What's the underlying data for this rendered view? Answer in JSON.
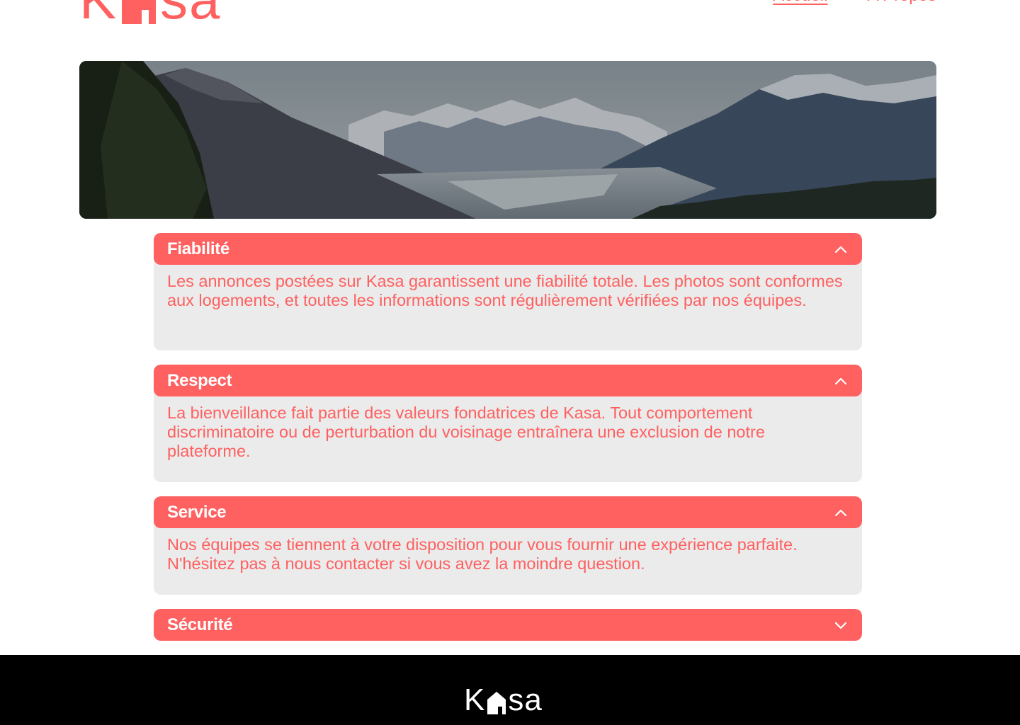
{
  "brand": {
    "logo_left": "K",
    "logo_right": "sa",
    "color": "#ff6060"
  },
  "nav": {
    "items": [
      {
        "label": "Accueil"
      },
      {
        "label": "A Propos"
      }
    ]
  },
  "banner": {
    "image": "mountain landscape banner"
  },
  "collapses": [
    {
      "title": "Fiabilité",
      "expanded": true,
      "icon": "chevron-up-icon",
      "text": "Les annonces postées sur Kasa garantissent une fiabilité totale. Les photos sont conformes aux logements, et toutes les informations sont régulièrement vérifiées par nos équipes."
    },
    {
      "title": "Respect",
      "expanded": true,
      "icon": "chevron-up-icon",
      "text": "La bienveillance fait partie des valeurs fondatrices de Kasa. Tout comportement discriminatoire ou de perturbation du voisinage entraînera une exclusion de notre plateforme."
    },
    {
      "title": "Service",
      "expanded": true,
      "icon": "chevron-up-icon",
      "text": "Nos équipes se tiennent à votre disposition pour vous fournir une expérience parfaite. N'hésitez pas à nous contacter si vous avez la moindre question."
    },
    {
      "title": "Sécurité",
      "expanded": false,
      "icon": "chevron-down-icon",
      "text": ""
    }
  ],
  "footer": {
    "logo_left": "K",
    "logo_right": "sa"
  },
  "colors": {
    "accent": "#ff6060",
    "panel": "#ebebeb",
    "footer_bg": "#000000"
  }
}
